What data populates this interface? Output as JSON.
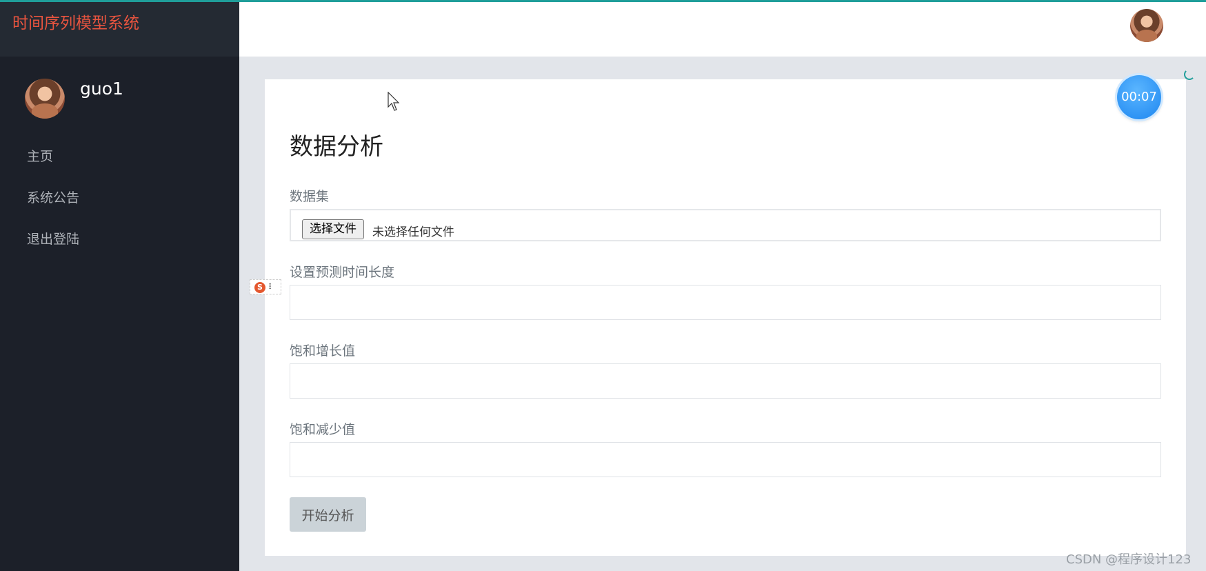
{
  "app": {
    "title": "时间序列模型系统"
  },
  "user": {
    "name": "guo1"
  },
  "sidebar": {
    "items": [
      {
        "label": "主页"
      },
      {
        "label": "系统公告"
      },
      {
        "label": "退出登陆"
      }
    ]
  },
  "form": {
    "title": "数据分析",
    "dataset_label": "数据集",
    "file_button": "选择文件",
    "file_status": "未选择任何文件",
    "predict_length_label": "设置预测时间长度",
    "predict_length_value": "",
    "sat_increase_label": "饱和增长值",
    "sat_increase_value": "",
    "sat_decrease_label": "饱和减少值",
    "sat_decrease_value": "",
    "submit_label": "开始分析"
  },
  "overlay": {
    "timer": "00:07",
    "ime_badge": "S",
    "watermark": "CSDN @程序设计123"
  },
  "colors": {
    "sidebar_bg": "#1c2029",
    "brand_text": "#e8543f",
    "accent": "#1f9e9a",
    "content_bg": "#e2e5ea"
  }
}
